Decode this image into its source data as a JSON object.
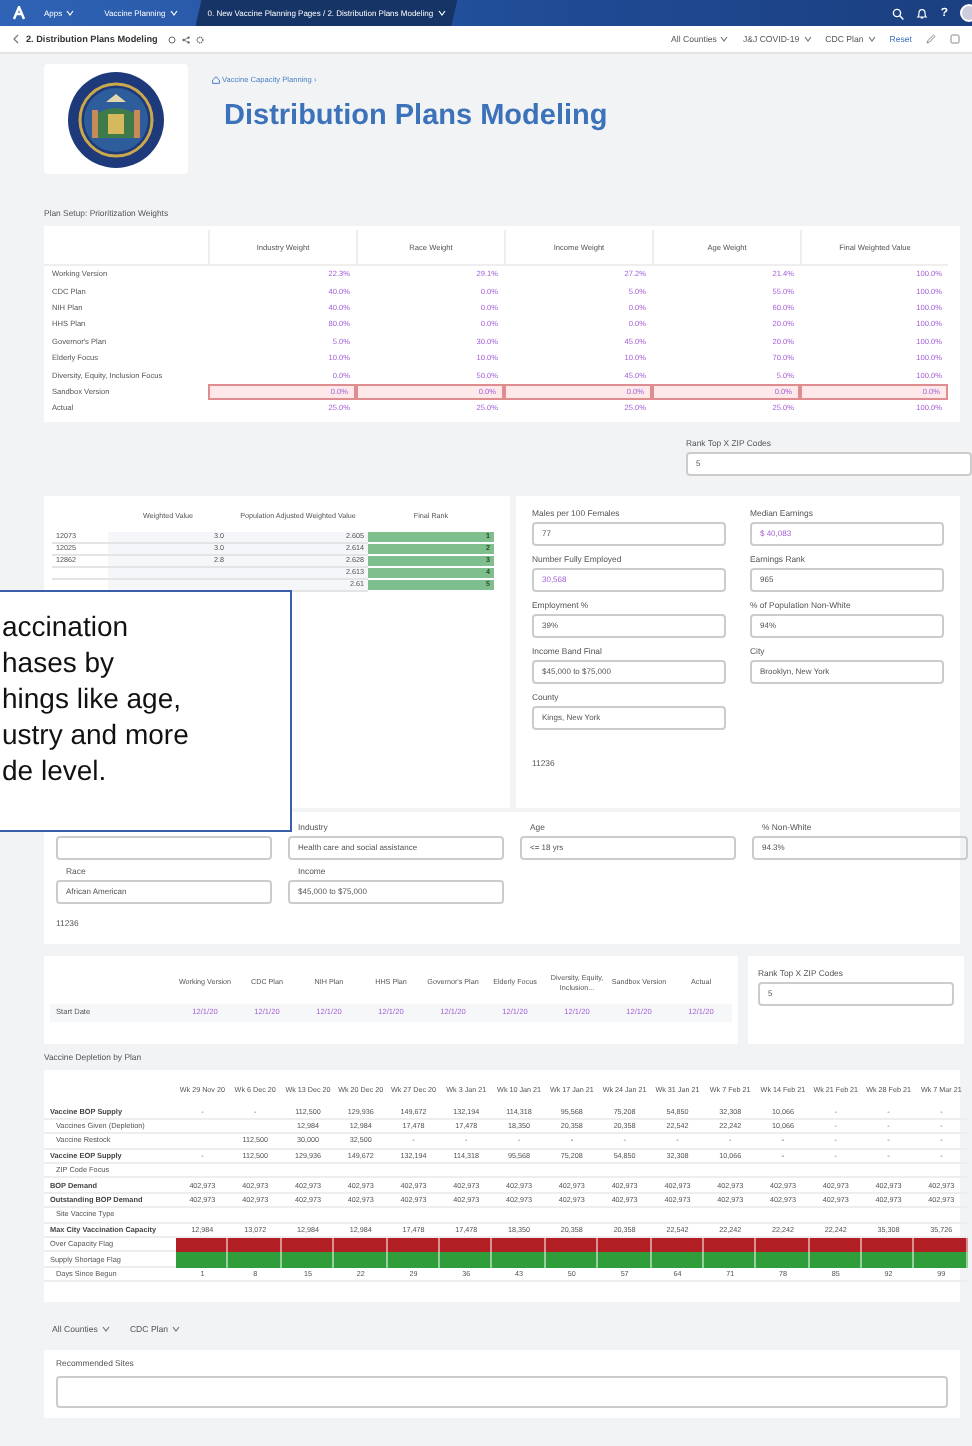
{
  "top_nav": {
    "items": [
      {
        "label": "Apps",
        "selected": false
      },
      {
        "label": "Vaccine Planning",
        "selected": false
      },
      {
        "label": "0. New Vaccine Planning Pages / 2. Distribution Plans Modeling",
        "selected": true
      }
    ],
    "help": "?"
  },
  "sub_header": {
    "title": "2. Distribution Plans Modeling",
    "filters": [
      "All Counties",
      "J&J COVID-19",
      "CDC Plan"
    ],
    "reset": "Reset"
  },
  "header": {
    "breadcrumb": "Vaccine Capacity Planning ›",
    "title": "Distribution Plans Modeling"
  },
  "weights": {
    "title": "Plan Setup: Prioritization Weights",
    "columns": [
      "Industry Weight",
      "Race Weight",
      "Income Weight",
      "Age Weight",
      "Final Weighted Value"
    ],
    "rows": [
      {
        "label": "Working Version",
        "editable": false,
        "values": [
          "22.3%",
          "29.1%",
          "27.2%",
          "21.4%",
          "100.0%"
        ]
      },
      {
        "label": "CDC Plan",
        "editable": false,
        "values": [
          "40.0%",
          "0.0%",
          "5.0%",
          "55.0%",
          "100.0%"
        ]
      },
      {
        "label": "NIH Plan",
        "editable": false,
        "values": [
          "40.0%",
          "0.0%",
          "0.0%",
          "60.0%",
          "100.0%"
        ]
      },
      {
        "label": "HHS Plan",
        "editable": false,
        "values": [
          "80.0%",
          "0.0%",
          "0.0%",
          "20.0%",
          "100.0%"
        ]
      },
      {
        "label": "Governor's Plan",
        "editable": false,
        "values": [
          "5.0%",
          "30.0%",
          "45.0%",
          "20.0%",
          "100.0%"
        ]
      },
      {
        "label": "Elderly Focus",
        "editable": false,
        "values": [
          "10.0%",
          "10.0%",
          "10.0%",
          "70.0%",
          "100.0%"
        ]
      },
      {
        "label": "Diversity, Equity, Inclusion Focus",
        "editable": false,
        "values": [
          "0.0%",
          "50.0%",
          "45.0%",
          "5.0%",
          "100.0%"
        ]
      },
      {
        "label": "Sandbox Version",
        "editable": true,
        "values": [
          "0.0%",
          "0.0%",
          "0.0%",
          "0.0%",
          "0.0%"
        ]
      },
      {
        "label": "Actual",
        "editable": false,
        "values": [
          "25.0%",
          "25.0%",
          "25.0%",
          "25.0%",
          "100.0%"
        ]
      }
    ]
  },
  "rank_top_zip": {
    "label": "Rank Top X ZIP Codes",
    "value": "5"
  },
  "zip_table": {
    "columns": [
      "Weighted Value",
      "Population Adjusted Weighted Value",
      "Final Rank"
    ],
    "rows": [
      {
        "zip": "12073",
        "weighted": "3.0",
        "adjusted": "2.605",
        "rank": "1"
      },
      {
        "zip": "12025",
        "weighted": "3.0",
        "adjusted": "2.614",
        "rank": "2"
      },
      {
        "zip": "12862",
        "weighted": "2.8",
        "adjusted": "2.628",
        "rank": "3"
      },
      {
        "adjusted": "2.613",
        "rank": "4"
      },
      {
        "adjusted": "2.61",
        "rank": "5"
      }
    ]
  },
  "zip_details": {
    "fields": [
      {
        "label": "Males per 100 Females",
        "value": "77",
        "accent": false
      },
      {
        "label": "Median Earnings",
        "value": "$ 40,083",
        "accent": true
      },
      {
        "label": "Number Fully Employed",
        "value": "30,568",
        "accent": true
      },
      {
        "label": "Earnings Rank",
        "value": "965",
        "accent": false
      },
      {
        "label": "Employment %",
        "value": "39%",
        "accent": false
      },
      {
        "label": "% of Population Non-White",
        "value": "94%",
        "accent": false
      },
      {
        "label": "Income Band Final",
        "value": "$45,000 to $75,000",
        "accent": false
      },
      {
        "label": "City",
        "value": "Brooklyn, New York",
        "accent": false
      },
      {
        "label": "County",
        "value": "Kings, New York",
        "accent": false
      }
    ],
    "zip": "11236"
  },
  "profile": {
    "fields": [
      {
        "kind": "blank"
      },
      {
        "kind": "field",
        "label": "Industry",
        "value": "Health care and social assistance"
      },
      {
        "kind": "field",
        "label": "Age",
        "value": "<= 18 yrs"
      },
      {
        "kind": "field",
        "label": "% Non-White",
        "value": "94.3%"
      },
      {
        "kind": "field",
        "label": "Race",
        "value": "African American"
      },
      {
        "kind": "field",
        "label": "Income",
        "value": "$45,000 to $75,000"
      }
    ],
    "zip": "11236"
  },
  "start_dates": {
    "columns": [
      "Working Version",
      "CDC Plan",
      "NIH Plan",
      "HHS Plan",
      "Governor's Plan",
      "Elderly Focus",
      "Diversity, Equity, Inclusion...",
      "Sandbox Version",
      "Actual"
    ],
    "row_label": "Start Date",
    "values": [
      "12/1/20",
      "12/1/20",
      "12/1/20",
      "12/1/20",
      "12/1/20",
      "12/1/20",
      "12/1/20",
      "12/1/20",
      "12/1/20"
    ]
  },
  "rank_top_zip_2": {
    "label": "Rank Top X ZIP Codes",
    "value": "5"
  },
  "depletion": {
    "title": "Vaccine Depletion by Plan",
    "columns": [
      "Wk 29 Nov 20",
      "Wk 6 Dec 20",
      "Wk 13 Dec 20",
      "Wk 20 Dec 20",
      "Wk 27 Dec 20",
      "Wk 3 Jan 21",
      "Wk 10 Jan 21",
      "Wk 17 Jan 21",
      "Wk 24 Jan 21",
      "Wk 31 Jan 21",
      "Wk 7 Feb 21",
      "Wk 14 Feb 21",
      "Wk 21 Feb 21",
      "Wk 28 Feb 21",
      "Wk 7 Mar 21"
    ],
    "rows": [
      {
        "label": "Vaccine BOP Supply",
        "kind": "main",
        "values": [
          "-",
          "-",
          "112,500",
          "129,936",
          "149,672",
          "132,194",
          "114,318",
          "95,568",
          "75,208",
          "54,850",
          "32,308",
          "10,066",
          "-",
          "-",
          "-"
        ]
      },
      {
        "label": "Vaccines Given (Depletion)",
        "kind": "sub",
        "values": [
          {
            "kind": "blank"
          },
          {
            "kind": "blank"
          },
          "12,984",
          "12,984",
          "17,478",
          "17,478",
          "18,350",
          "20,358",
          "20,358",
          "22,542",
          "22,242",
          "10,066",
          "-",
          "-",
          "-"
        ]
      },
      {
        "label": "Vaccine Restock",
        "kind": "sub",
        "values": [
          {
            "kind": "blank"
          },
          "112,500",
          "30,000",
          "32,500",
          "-",
          "-",
          "-",
          "-",
          "-",
          "-",
          "-",
          "-",
          "-",
          "-",
          "-"
        ]
      },
      {
        "label": "Vaccine EOP Supply",
        "kind": "main",
        "values": [
          "-",
          "112,500",
          "129,936",
          "149,672",
          "132,194",
          "114,318",
          "95,568",
          "75,208",
          "54,850",
          "32,308",
          "10,066",
          "-",
          "-",
          "-",
          "-"
        ]
      },
      {
        "label": "ZIP Code Focus",
        "kind": "sub"
      },
      {
        "label": "BOP Demand",
        "kind": "main",
        "values": [
          "402,973",
          "402,973",
          "402,973",
          "402,973",
          "402,973",
          "402,973",
          "402,973",
          "402,973",
          "402,973",
          "402,973",
          "402,973",
          "402,973",
          "402,973",
          "402,973",
          "402,973"
        ]
      },
      {
        "label": "Outstanding BOP Demand",
        "kind": "main",
        "values": [
          "402,973",
          "402,973",
          "402,973",
          "402,973",
          "402,973",
          "402,973",
          "402,973",
          "402,973",
          "402,973",
          "402,973",
          "402,973",
          "402,973",
          "402,973",
          "402,973",
          "402,973"
        ]
      },
      {
        "label": "Site Vaccine Type",
        "kind": "sub"
      },
      {
        "label": "Max City Vaccination Capacity",
        "kind": "main",
        "values": [
          "12,984",
          "13,072",
          "12,984",
          "12,984",
          "17,478",
          "17,478",
          "18,350",
          "20,358",
          "20,358",
          "22,542",
          "22,242",
          "22,242",
          "22,242",
          "35,308",
          "35,726"
        ]
      },
      {
        "label": "Over Capacity Flag",
        "kind": "flag",
        "color": "#b11f24"
      },
      {
        "label": "Supply Shortage Flag",
        "kind": "flag",
        "color": "#2f9e3a"
      },
      {
        "label": "Days Since Begun",
        "kind": "sub",
        "values": [
          "1",
          "8",
          "15",
          "22",
          "29",
          "36",
          "43",
          "50",
          "57",
          "64",
          "71",
          "78",
          "85",
          "92",
          "99"
        ]
      }
    ]
  },
  "bottom_filters": [
    "All Counties",
    "CDC Plan"
  ],
  "recommended_sites": {
    "label": "Recommended Sites"
  },
  "caption": {
    "text": "accination\nhases by\nhings like age,\nustry and more\nde level."
  }
}
